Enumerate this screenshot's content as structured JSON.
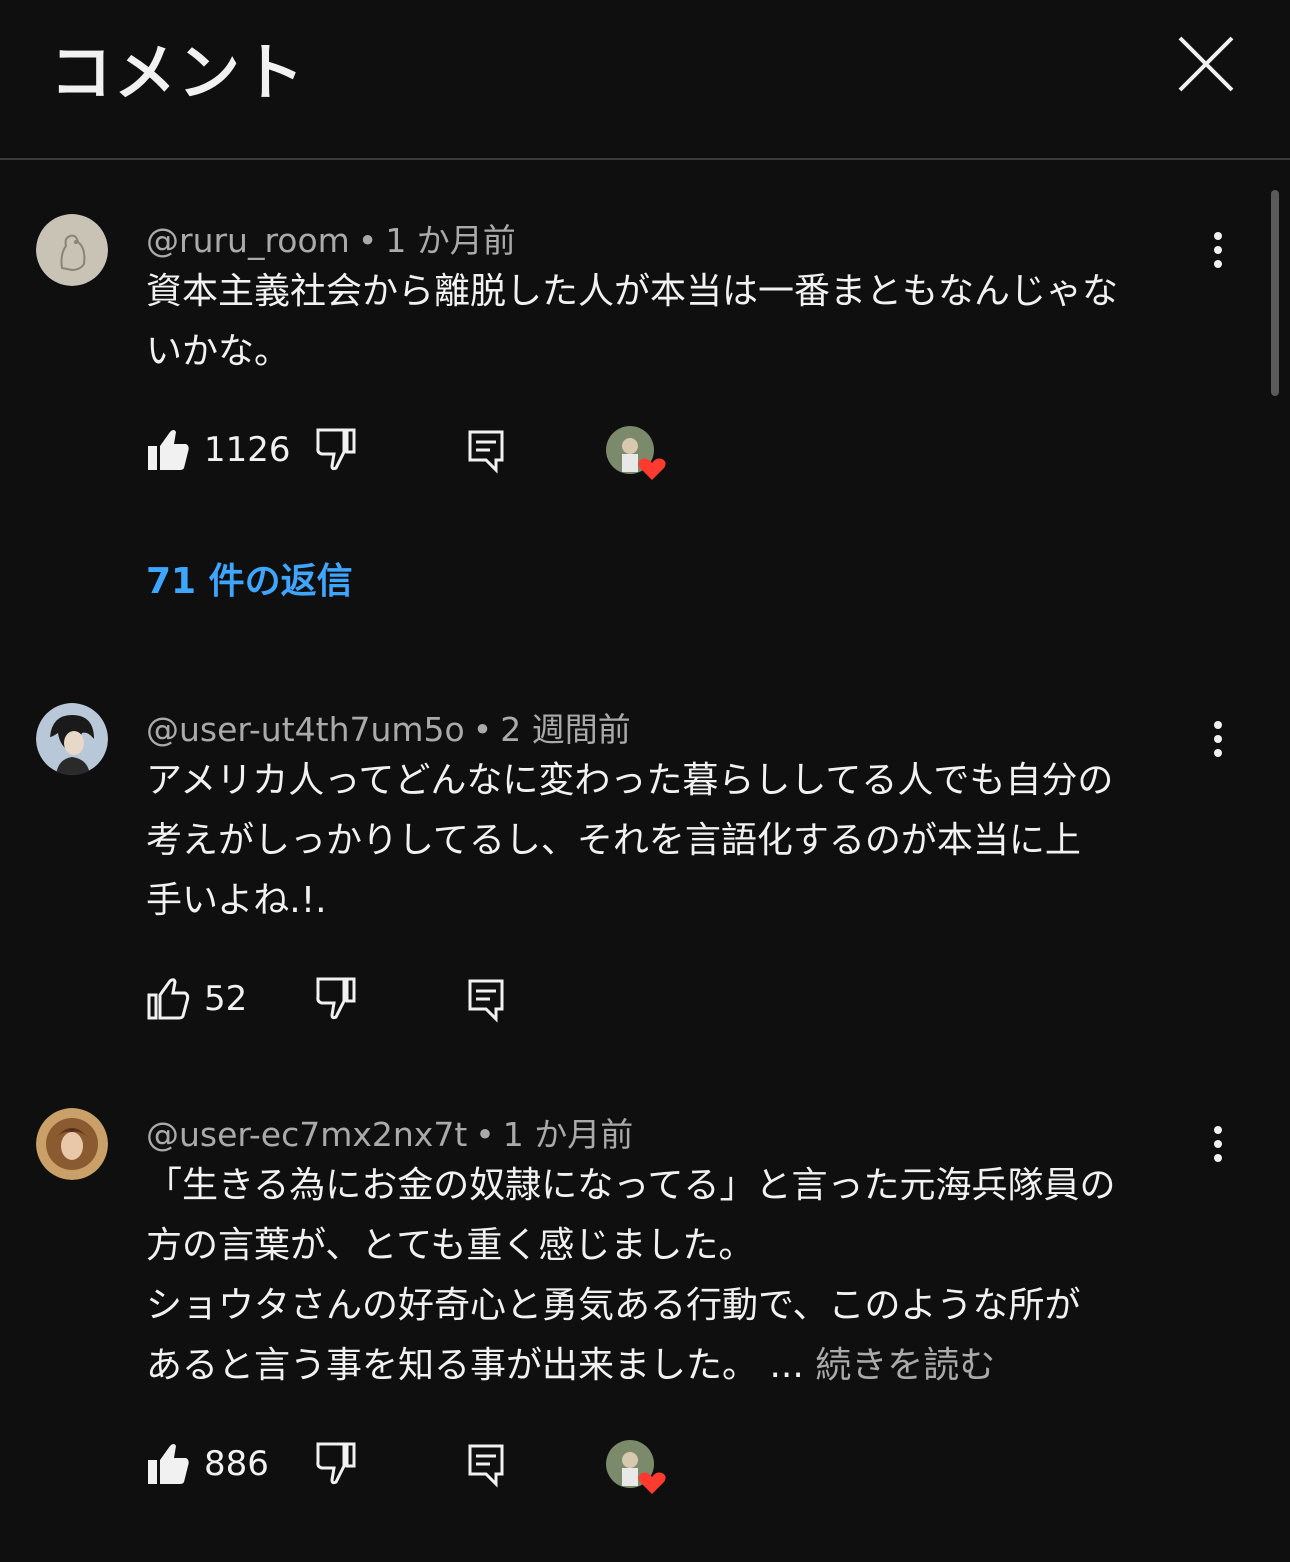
{
  "header": {
    "title": "コメント"
  },
  "comments": [
    {
      "author": "@ruru_room",
      "sep": "•",
      "time": "1 か月前",
      "lines": [
        "資本主義社会から離脱した人が本当は一番まともなんじゃな",
        "いかな。"
      ],
      "likes": "1126",
      "liked": true,
      "creator_hearted": true,
      "replies": "71 件の返信"
    },
    {
      "author": "@user-ut4th7um5o",
      "sep": "•",
      "time": "2 週間前",
      "lines": [
        "アメリカ人ってどんなに変わった暮らししてる人でも自分の",
        "考えがしっかりしてるし、それを言語化するのが本当に上",
        "手いよね.!."
      ],
      "likes": "52",
      "liked": false,
      "creator_hearted": false
    },
    {
      "author": "@user-ec7mx2nx7t",
      "sep": "•",
      "time": "1 か月前",
      "lines": [
        "「生きる為にお金の奴隷になってる」と言った元海兵隊員の",
        "方の言葉が、とても重く感じました。",
        "ショウタさんの好奇心と勇気ある行動で、このような所が",
        "あると言う事を知る事が出来ました。"
      ],
      "ellipsis": "...",
      "more": "続きを読む",
      "likes": "886",
      "liked": true,
      "creator_hearted": true
    }
  ],
  "colors": {
    "background": "#0f0f0f",
    "link": "#3ea6ff",
    "meta": "#aaaaaa",
    "heart": "#ff3b30"
  },
  "icons": [
    "close-icon",
    "kebab-menu-icon",
    "thumbs-up-icon",
    "thumbs-down-icon",
    "reply-icon",
    "creator-heart-icon"
  ]
}
